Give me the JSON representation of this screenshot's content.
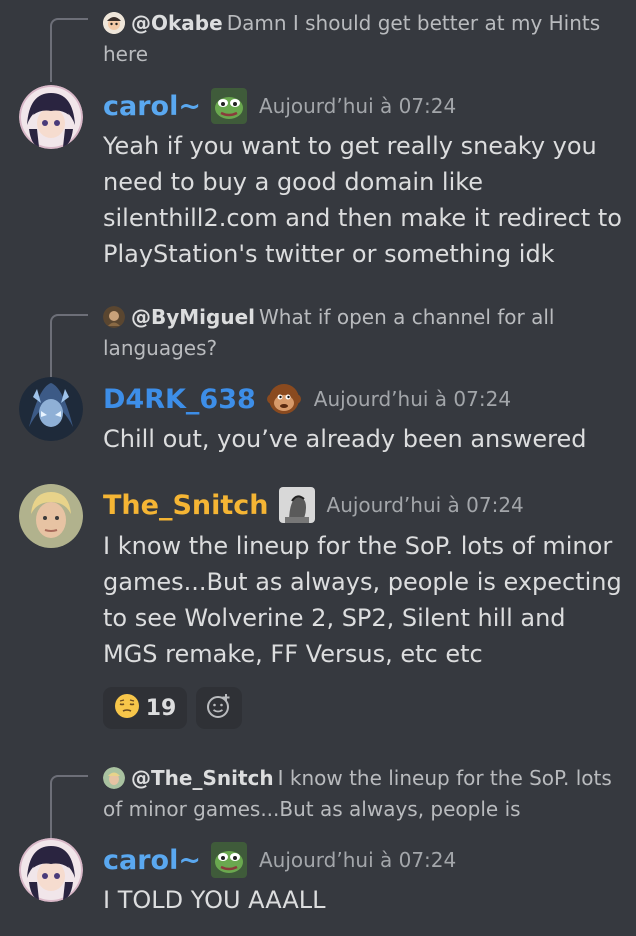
{
  "messages": [
    {
      "reply": {
        "mention": "@Okabe",
        "text": "Damn I should get better at my Hints here"
      },
      "author": "carol~",
      "author_color": "#5aa8f0",
      "time": "Aujourd’hui à 07:24",
      "avatar": "carol-avatar",
      "badge": "pepe-badge-icon",
      "content": "Yeah if you want to get really sneaky you need to buy a good domain like silenthill2.com and then make it redirect to PlayStation's twitter or something idk"
    },
    {
      "reply": {
        "mention": "@ByMiguel",
        "text": "What if open a channel for all languages?"
      },
      "author": "D4RK_638",
      "author_color": "#3d8ee8",
      "time": "Aujourd’hui à 07:24",
      "avatar": "d4rk-avatar",
      "badge": "monkey-badge-icon",
      "content": "Chill out, you’ve already been answered"
    },
    {
      "author": "The_Snitch",
      "author_color": "#f5b534",
      "time": "Aujourd’hui à 07:24",
      "avatar": "snitch-avatar",
      "badge": "chad-badge-icon",
      "content": "I know the lineup for the SoP. lots of minor games...But as always, people is expecting to see Wolverine 2, SP2, Silent hill and MGS remake, FF Versus, etc etc",
      "reactions": [
        {
          "emoji": "😔",
          "count": "19"
        }
      ],
      "add_reaction_icon": "add-reaction-icon"
    },
    {
      "reply": {
        "mention": "@The_Snitch",
        "text": "I know the lineup for the SoP. lots of minor games...But as always, people is"
      },
      "author": "carol~",
      "author_color": "#5aa8f0",
      "time": "Aujourd’hui à 07:24",
      "avatar": "carol-avatar",
      "badge": "pepe-badge-icon",
      "content": "I TOLD YOU AAALL"
    }
  ]
}
